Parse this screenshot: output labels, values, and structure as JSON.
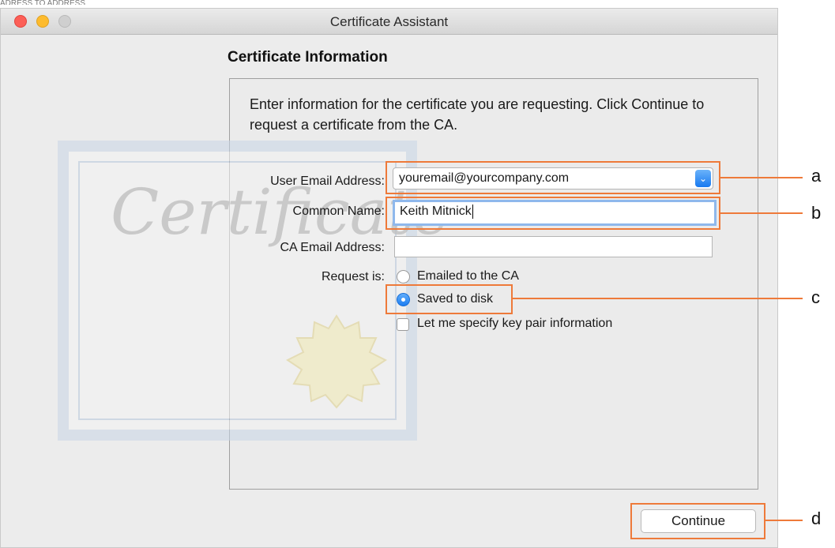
{
  "window": {
    "title": "Certificate Assistant"
  },
  "form": {
    "heading": "Certificate Information",
    "intro": "Enter information for the certificate you are requesting. Click Continue to request a certificate from the CA.",
    "user_email_label": "User Email Address:",
    "user_email_value": "youremail@yourcompany.com",
    "common_name_label": "Common Name:",
    "common_name_value": "Keith Mitnick",
    "ca_email_label": "CA Email Address:",
    "ca_email_value": "",
    "request_label": "Request is:",
    "request_options": [
      {
        "label": "Emailed to the CA",
        "selected": false
      },
      {
        "label": "Saved to disk",
        "selected": true
      }
    ],
    "key_pair_label": "Let me specify key pair information",
    "key_pair_checked": false
  },
  "buttons": {
    "continue_label": "Continue"
  },
  "background_art": {
    "cert_word": "Certificate"
  },
  "annotations": {
    "a": "a",
    "b": "b",
    "c": "c",
    "d": "d"
  },
  "colors": {
    "annotation": "#ee7a3a",
    "accent": "#1d7ef2"
  },
  "icons": [
    "close-dot",
    "minimize-dot",
    "zoom-dot",
    "chevron-down-icon",
    "radio-selected-icon",
    "seal-icon"
  ]
}
